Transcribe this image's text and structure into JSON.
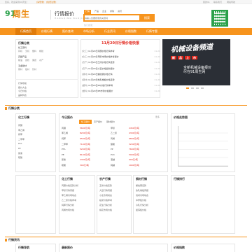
{
  "topbar": {
    "left_text": "您好，欢迎来到91周生！",
    "login": "[请登录]",
    "register": "[免费注册]",
    "right_links": [
      "我的91",
      "联系我们",
      "网站导航"
    ]
  },
  "logo": {
    "mark": "91",
    "name": "周生",
    "slogan": "行情报价",
    "slogan_sub": "HANGQING BAOJIA"
  },
  "search": {
    "tabs": [
      "行情",
      "产品",
      "企业",
      "求购",
      "资讯"
    ],
    "active_tab": "行情",
    "placeholder": "请输入您要搜索的关键词",
    "button": "搜索",
    "hotwords": "热门搜索："
  },
  "nav": {
    "items": [
      "行情首页",
      "价格行情",
      "报价查询",
      "市场分析",
      "行业资讯",
      "价格指数",
      "行情专题"
    ],
    "active": 0
  },
  "left_menu": {
    "title": "行情分类",
    "groups": [
      {
        "name": "化工原料",
        "items": [
          "有机",
          "无机",
          "塑料",
          "橡胶"
        ]
      },
      {
        "name": "农副产品",
        "items": [
          "粮油",
          "畜牧",
          "果蔬",
          "水产"
        ]
      },
      {
        "name": "五金建材",
        "items": [
          "钢材",
          "板材",
          "管材"
        ]
      }
    ],
    "links": [
      "行情导航",
      "报价大全",
      "今日价格",
      "品种列表"
    ]
  },
  "headline": {
    "title": "11月20日行情价格快报",
    "rows": [
      {
        "tag": "[化工]",
        "title": "11月20日丙酮价格行情参考",
        "date": "11-20"
      },
      {
        "tag": "[化工]",
        "title": "11月20日甲醇市场价格参考报价",
        "date": "11-20"
      },
      {
        "tag": "[农产]",
        "title": "11月20日玉米价格行情走势",
        "date": "11-20"
      },
      {
        "tag": "[农产]",
        "title": "11月20日大豆价格最新报价",
        "date": "11-20"
      },
      {
        "tag": "[钢材]",
        "title": "11月20日螺纹钢价格行情",
        "date": "11-20"
      },
      {
        "tag": "[钢材]",
        "title": "11月20日热轧卷板价格走势",
        "date": "11-20"
      },
      {
        "tag": "[塑料]",
        "title": "11月20日PP价格行情参考",
        "date": "11-20"
      },
      {
        "tag": "[塑料]",
        "title": "11月20日PE市场价格报价",
        "date": "11-20"
      }
    ]
  },
  "promo": {
    "big": "机械设备频道",
    "tags": [
      "新",
      "品",
      "上",
      "市"
    ],
    "sub_line1": "全新机械设备报价",
    "sub_line2": "尽在91周生网"
  },
  "section1": {
    "title": "行情分类",
    "left_title": "化工行情",
    "mid_title": "今日报价",
    "mid_tabs": [
      "化工报价",
      "农产报价",
      "钢材报价"
    ],
    "mid_tab_active": 0,
    "rows": [
      {
        "name": "丙酮",
        "price": "5600元/吨",
        "name2": "甲醇",
        "price2": "2450元/吨"
      },
      {
        "name": "苯乙烯",
        "price": "8200元/吨",
        "name2": "乙二醇",
        "price2": "4300元/吨"
      },
      {
        "name": "纯苯",
        "price": "6500元/吨",
        "name2": "丙烯",
        "price2": "6800元/吨"
      },
      {
        "name": "二甲苯",
        "price": "7100元/吨",
        "name2": "醋酸",
        "price2": "3200元/吨"
      },
      {
        "name": "PTA",
        "price": "5200元/吨",
        "name2": "PP",
        "price2": "7600元/吨"
      },
      {
        "name": "PE",
        "price": "8100元/吨",
        "name2": "PVC",
        "price2": "5900元/吨"
      },
      {
        "name": "尿素",
        "price": "2300元/吨",
        "name2": "液碱",
        "price2": "900元/吨"
      },
      {
        "name": "硫酸",
        "price": "300元/吨",
        "name2": "纯碱",
        "price2": "1900元/吨"
      }
    ],
    "right_title": "价格走势图",
    "more": "更多"
  },
  "section1_bottom": {
    "cols": [
      {
        "title": "化工行情",
        "items": [
          "丙酮价格走势分析",
          "甲醇行情周报",
          "苯乙烯市场动态",
          "乙二醇价格参考",
          "纯苯行情分析",
          "丙烯市场价格"
        ]
      },
      {
        "title": "农产行情",
        "items": [
          "玉米价格走势",
          "大豆行情周报",
          "小麦市场动态",
          "稻米价格参考",
          "花生行情分析",
          "棉花市场价格"
        ]
      },
      {
        "title": "钢材行情",
        "items": [
          "螺纹钢走势",
          "热轧卷板周报",
          "线材市场动态",
          "中厚板价格",
          "冷轧行情分析",
          "镀锌板价格"
        ]
      }
    ],
    "right_title": "行情排行"
  },
  "section2": {
    "title": "行情资讯",
    "left_title": "行情导航",
    "mid_title": "最新报价",
    "right_title": "价格指数"
  }
}
